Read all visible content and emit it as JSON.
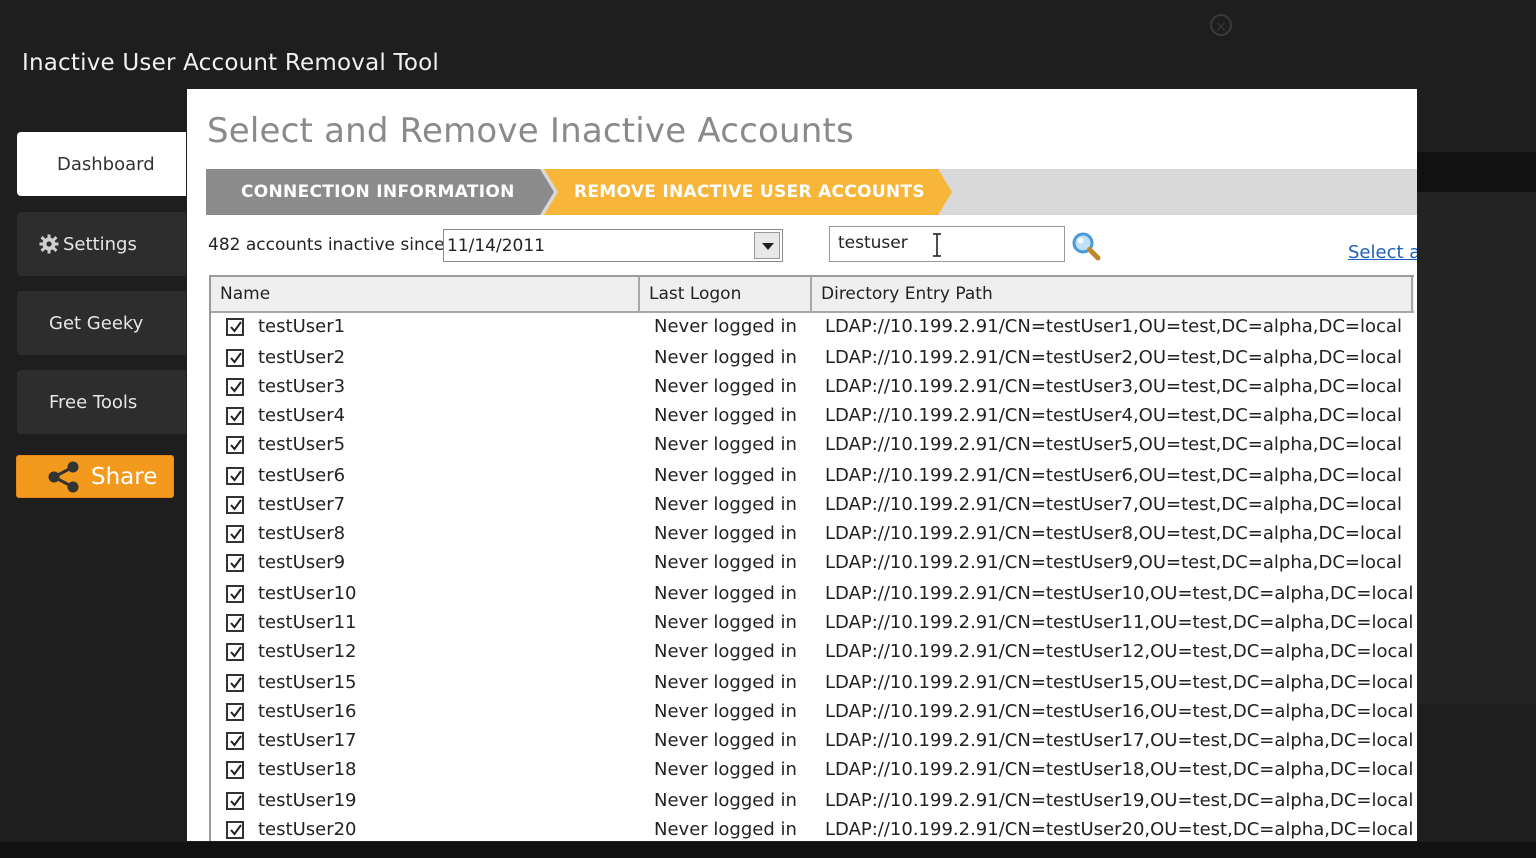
{
  "window": {
    "title": "Inactive User Account Removal Tool"
  },
  "sidebar": {
    "items": [
      {
        "label": "Dashboard",
        "active": true
      },
      {
        "label": "Settings",
        "icon": "gear-icon"
      },
      {
        "label": "Get Geeky"
      },
      {
        "label": "Free Tools"
      }
    ],
    "share_label": "Share"
  },
  "main": {
    "title": "Select and Remove Inactive Accounts",
    "steps": [
      "CONNECTION INFORMATION",
      "REMOVE INACTIVE USER ACCOUNTS"
    ],
    "filter_label": "482 accounts inactive since",
    "date_value": "11/14/2011",
    "search_value": "testuser",
    "select_all_label": "Select al"
  },
  "table": {
    "columns": [
      "Name",
      "Last Logon",
      "Directory Entry Path"
    ],
    "rows": [
      {
        "name": "testUser1",
        "logon": "Never logged in",
        "path": "LDAP://10.199.2.91/CN=testUser1,OU=test,DC=alpha,DC=local",
        "checked": true
      },
      {
        "name": "testUser2",
        "logon": "Never logged in",
        "path": "LDAP://10.199.2.91/CN=testUser2,OU=test,DC=alpha,DC=local",
        "checked": true
      },
      {
        "name": "testUser3",
        "logon": "Never logged in",
        "path": "LDAP://10.199.2.91/CN=testUser3,OU=test,DC=alpha,DC=local",
        "checked": true
      },
      {
        "name": "testUser4",
        "logon": "Never logged in",
        "path": "LDAP://10.199.2.91/CN=testUser4,OU=test,DC=alpha,DC=local",
        "checked": true
      },
      {
        "name": "testUser5",
        "logon": "Never logged in",
        "path": "LDAP://10.199.2.91/CN=testUser5,OU=test,DC=alpha,DC=local",
        "checked": true
      },
      {
        "name": "testUser6",
        "logon": "Never logged in",
        "path": "LDAP://10.199.2.91/CN=testUser6,OU=test,DC=alpha,DC=local",
        "checked": true
      },
      {
        "name": "testUser7",
        "logon": "Never logged in",
        "path": "LDAP://10.199.2.91/CN=testUser7,OU=test,DC=alpha,DC=local",
        "checked": true
      },
      {
        "name": "testUser8",
        "logon": "Never logged in",
        "path": "LDAP://10.199.2.91/CN=testUser8,OU=test,DC=alpha,DC=local",
        "checked": true
      },
      {
        "name": "testUser9",
        "logon": "Never logged in",
        "path": "LDAP://10.199.2.91/CN=testUser9,OU=test,DC=alpha,DC=local",
        "checked": true
      },
      {
        "name": "testUser10",
        "logon": "Never logged in",
        "path": "LDAP://10.199.2.91/CN=testUser10,OU=test,DC=alpha,DC=local",
        "checked": true
      },
      {
        "name": "testUser11",
        "logon": "Never logged in",
        "path": "LDAP://10.199.2.91/CN=testUser11,OU=test,DC=alpha,DC=local",
        "checked": true
      },
      {
        "name": "testUser12",
        "logon": "Never logged in",
        "path": "LDAP://10.199.2.91/CN=testUser12,OU=test,DC=alpha,DC=local",
        "checked": true
      },
      {
        "name": "testUser15",
        "logon": "Never logged in",
        "path": "LDAP://10.199.2.91/CN=testUser15,OU=test,DC=alpha,DC=local",
        "checked": true
      },
      {
        "name": "testUser16",
        "logon": "Never logged in",
        "path": "LDAP://10.199.2.91/CN=testUser16,OU=test,DC=alpha,DC=local",
        "checked": true
      },
      {
        "name": "testUser17",
        "logon": "Never logged in",
        "path": "LDAP://10.199.2.91/CN=testUser17,OU=test,DC=alpha,DC=local",
        "checked": true
      },
      {
        "name": "testUser18",
        "logon": "Never logged in",
        "path": "LDAP://10.199.2.91/CN=testUser18,OU=test,DC=alpha,DC=local",
        "checked": true
      },
      {
        "name": "testUser19",
        "logon": "Never logged in",
        "path": "LDAP://10.199.2.91/CN=testUser19,OU=test,DC=alpha,DC=local",
        "checked": true
      },
      {
        "name": "testUser20",
        "logon": "Never logged in",
        "path": "LDAP://10.199.2.91/CN=testUser20,OU=test,DC=alpha,DC=local",
        "checked": true
      }
    ]
  },
  "colors": {
    "accent": "#f39a1e",
    "step_active": "#f7b53a",
    "step_inactive": "#8c8c8c",
    "link": "#1a5fbf"
  }
}
